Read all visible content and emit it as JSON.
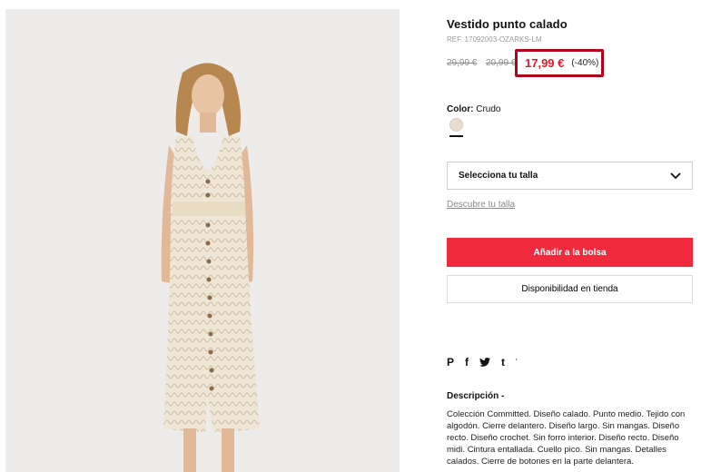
{
  "product": {
    "title": "Vestido punto calado",
    "ref": "REF. 17092003-OZARKS-LM",
    "price_old_1": "29,99 €",
    "price_old_2": "20,99 €",
    "price_now": "17,99 €",
    "discount": "(-40%)",
    "highlight_color": "#b3001b",
    "price_color": "#e0192a"
  },
  "color": {
    "label": "Color:",
    "value": "Crudo",
    "swatch": "#e7dccd"
  },
  "size": {
    "select_label": "Selecciona tu talla",
    "help_link": "Descubre tu talla"
  },
  "actions": {
    "add_to_bag": "Añadir a la bolsa",
    "add_color": "#f1293c",
    "store_availability": "Disponibilidad en tienda"
  },
  "share": {
    "icons": [
      "pinterest-icon",
      "facebook-icon",
      "twitter-icon",
      "tumblr-icon"
    ],
    "pinterest": "P",
    "facebook": "f",
    "twitter": "🐦",
    "tumblr": "t",
    "more": "'"
  },
  "description": {
    "title": "Descripción -",
    "text": "Colección Committed. Diseño calado. Punto medio. Tejido con algodón. Cierre delantero. Diseño largo. Sin mangas. Diseño recto. Diseño crochet. Sin forro interior. Diseño recto. Diseño midi. Cintura entallada. Cuello pico. Sin mangas. Detalles calados. Cierre de botones en la parte delantera."
  }
}
